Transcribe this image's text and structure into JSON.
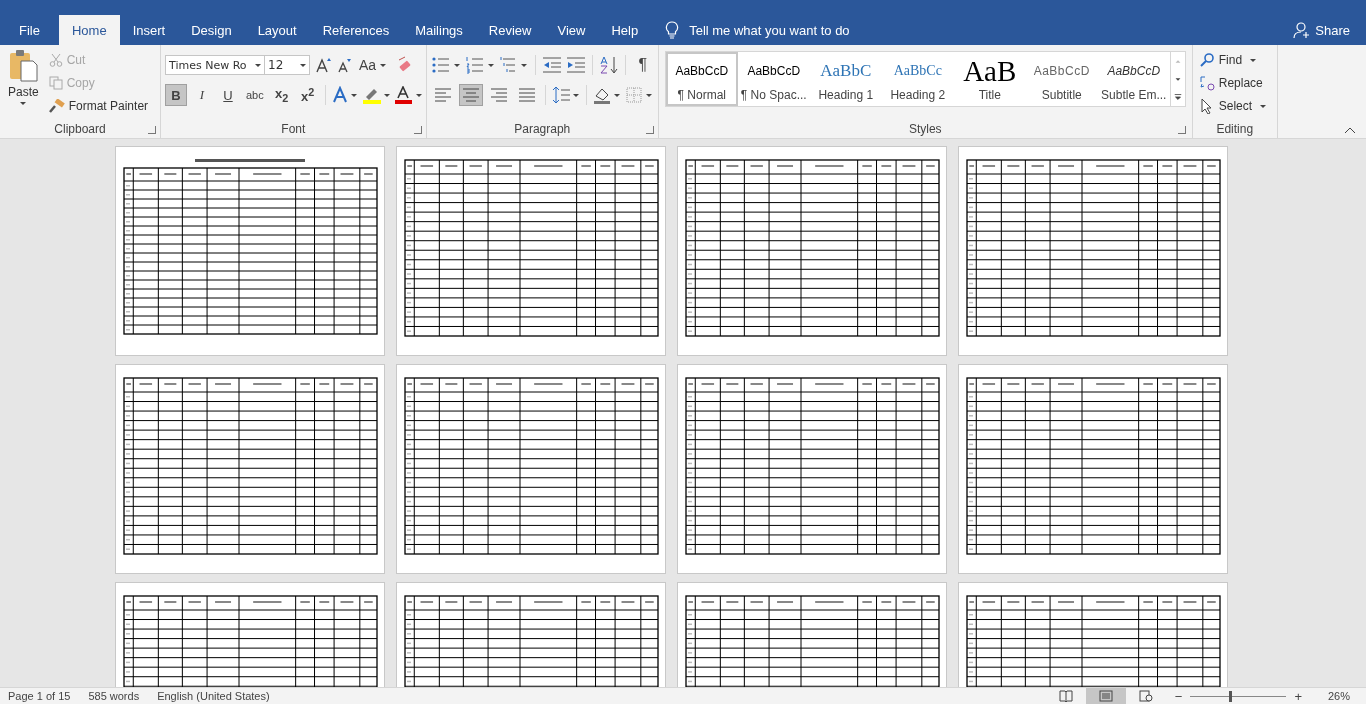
{
  "tabs": [
    {
      "label": "File",
      "selected": false
    },
    {
      "label": "Home",
      "selected": true
    },
    {
      "label": "Insert",
      "selected": false
    },
    {
      "label": "Design",
      "selected": false
    },
    {
      "label": "Layout",
      "selected": false
    },
    {
      "label": "References",
      "selected": false
    },
    {
      "label": "Mailings",
      "selected": false
    },
    {
      "label": "Review",
      "selected": false
    },
    {
      "label": "View",
      "selected": false
    },
    {
      "label": "Help",
      "selected": false
    }
  ],
  "tell_me": {
    "placeholder": "Tell me what you want to do"
  },
  "share": "Share",
  "clipboard": {
    "group": "Clipboard",
    "paste": "Paste",
    "cut": {
      "label": "Cut",
      "disabled": true
    },
    "copy": {
      "label": "Copy",
      "disabled": true
    },
    "format_painter": "Format Painter"
  },
  "font": {
    "group": "Font",
    "family": "Times New Ro",
    "size": "12",
    "change_case": "Aa",
    "buttons": [
      {
        "kind": "bold",
        "label": "B",
        "selected": true
      },
      {
        "kind": "italic",
        "label": "I",
        "selected": false
      },
      {
        "kind": "underline",
        "label": "U",
        "selected": false
      },
      {
        "kind": "strike",
        "label": "abc",
        "selected": false
      },
      {
        "kind": "sub",
        "label": "x$_{2}$",
        "selected": false
      },
      {
        "kind": "sup",
        "label": "x$^{2}$",
        "selected": false
      }
    ]
  },
  "paragraph": {
    "group": "Paragraph",
    "pilcrow": "¶",
    "alignments": [
      {
        "kind": "left",
        "selected": false
      },
      {
        "kind": "center",
        "selected": true
      },
      {
        "kind": "right",
        "selected": false
      },
      {
        "kind": "justify",
        "selected": false
      }
    ]
  },
  "styles": {
    "group": "Styles",
    "items": [
      {
        "kind": "normal",
        "sample": "AaBbCcD",
        "label": "¶ Normal",
        "selected": true
      },
      {
        "kind": "normal",
        "sample": "AaBbCcD",
        "label": "¶ No Spac...",
        "selected": false
      },
      {
        "kind": "heading1",
        "sample": "AaBbC",
        "label": "Heading 1",
        "selected": false
      },
      {
        "kind": "heading2",
        "sample": "AaBbCc",
        "label": "Heading 2",
        "selected": false
      },
      {
        "kind": "title",
        "sample": "AaB",
        "label": "Title",
        "selected": false
      },
      {
        "kind": "subtitle",
        "sample": "AaBbCcD",
        "label": "Subtitle",
        "selected": false
      },
      {
        "kind": "emphasis",
        "sample": "AaBbCcD",
        "label": "Subtle Em...",
        "selected": false
      }
    ]
  },
  "editing": {
    "group": "Editing",
    "find": "Find",
    "replace": "Replace",
    "select": "Select"
  },
  "pages": [
    {
      "heading": true
    },
    {
      "heading": false
    },
    {
      "heading": false
    },
    {
      "heading": false
    },
    {
      "heading": false
    },
    {
      "heading": false
    },
    {
      "heading": false
    },
    {
      "heading": false
    },
    {
      "heading": false
    },
    {
      "heading": false
    },
    {
      "heading": false
    },
    {
      "heading": false
    }
  ],
  "status": {
    "zoom_out": "−",
    "zoom_in": "+",
    "page": "Page 1 of 15",
    "words": "585 words",
    "language": "English (United States)",
    "zoom": "26%",
    "views": [
      {
        "kind": "read",
        "selected": false
      },
      {
        "kind": "print",
        "selected": true
      },
      {
        "kind": "web",
        "selected": false
      }
    ],
    "zoom_slider": {
      "level": 0.4
    }
  }
}
